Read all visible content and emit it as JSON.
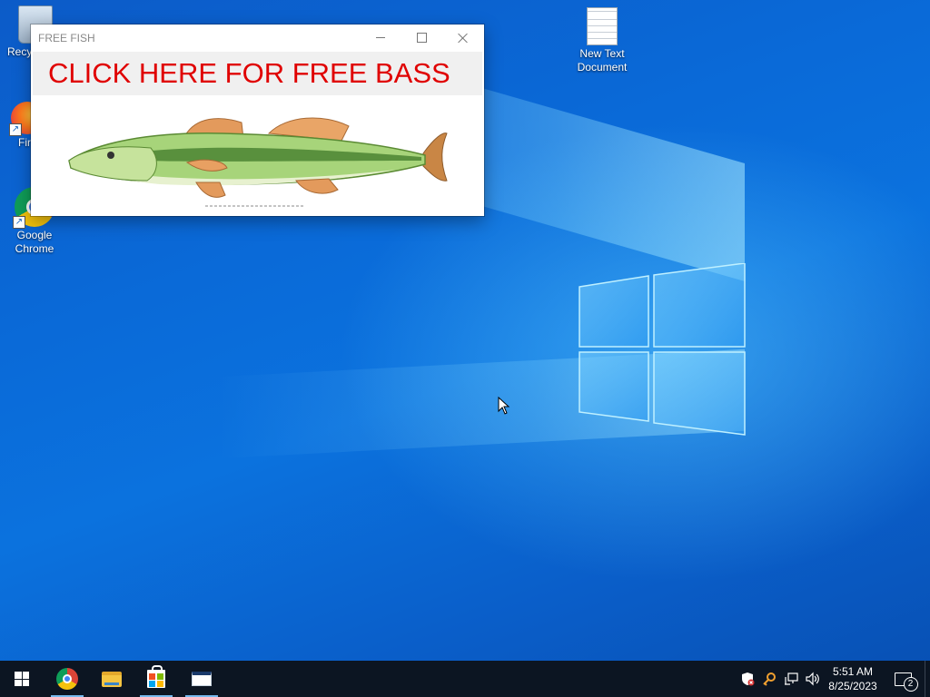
{
  "desktop": {
    "icons": [
      {
        "name": "recycle-bin",
        "label": "Recy"
      },
      {
        "name": "firefox",
        "label": "Fir"
      },
      {
        "name": "google-chrome",
        "label": "Google Chrome"
      },
      {
        "name": "new-text-document",
        "label": "New Text Document"
      }
    ]
  },
  "popup": {
    "title": "FREE FISH",
    "banner": "CLICK HERE FOR FREE BASS",
    "banner_color": "#e00000",
    "image_icon": "largemouth-bass"
  },
  "taskbar": {
    "start_icon": "windows-start-icon",
    "pinned": [
      {
        "name": "google-chrome",
        "icon": "chrome-icon",
        "active": true
      },
      {
        "name": "file-explorer",
        "icon": "folder-icon",
        "active": false
      },
      {
        "name": "microsoft-store",
        "icon": "store-bag-icon",
        "active": true
      },
      {
        "name": "free-fish-window",
        "icon": "app-window-icon",
        "active": true
      }
    ],
    "tray_icons": [
      "security-shield-icon",
      "key-icon",
      "network-icon",
      "volume-icon"
    ],
    "clock": {
      "time": "5:51 AM",
      "date": "8/25/2023"
    },
    "notifications_count": "2"
  },
  "colors": {
    "taskbar_bg": "#0c1522",
    "desktop_blue": "#0a6ad8"
  }
}
